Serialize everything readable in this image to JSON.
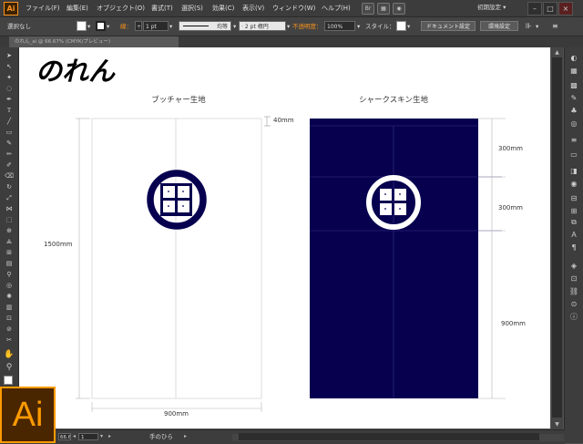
{
  "menubar": {
    "logo": "Ai",
    "items": [
      "ファイル(F)",
      "編集(E)",
      "オブジェクト(O)",
      "書式(T)",
      "選択(S)",
      "効果(C)",
      "表示(V)",
      "ウィンドウ(W)",
      "ヘルプ(H)"
    ],
    "workspace": "初期設定"
  },
  "controlbar": {
    "selection_status": "選択なし",
    "stroke_label": "線：",
    "stroke_weight": "1 pt",
    "profile": "均等",
    "brush": "2 pt 楕円",
    "opacity_label": "不透明度：",
    "opacity_value": "100%",
    "style_label": "スタイル：",
    "doc_setup": "ドキュメント設定",
    "prefs": "環境設定"
  },
  "doctab": {
    "title": "のれん_ai @ 66.67% (CMYK/プレビュー)"
  },
  "artwork": {
    "title": "のれん",
    "butcher_label": "ブッチャー生地",
    "shark_label": "シャークスキン生地",
    "dim_height": "1500mm",
    "dim_width": "900mm",
    "dim_top": "40mm",
    "dim_seg1": "300mm",
    "dim_seg2": "300mm",
    "dim_seg3": "900mm",
    "navy_color": "#06004f"
  },
  "statusbar": {
    "zoom": "66.67%",
    "page": "1",
    "tool_name": "手のひら"
  },
  "app_logo": "Ai"
}
